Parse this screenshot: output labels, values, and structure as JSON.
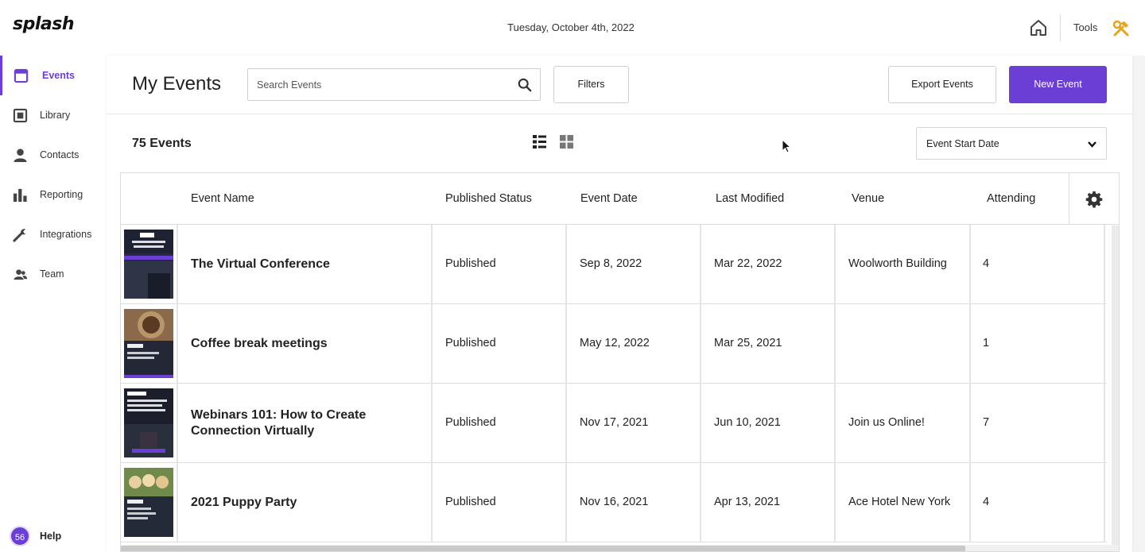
{
  "app": {
    "logo": "splash",
    "date": "Tuesday, October 4th, 2022",
    "tools_label": "Tools"
  },
  "sidebar": {
    "items": [
      {
        "label": "Events",
        "icon": "calendar-icon",
        "active": true
      },
      {
        "label": "Library",
        "icon": "library-icon",
        "active": false
      },
      {
        "label": "Contacts",
        "icon": "person-icon",
        "active": false
      },
      {
        "label": "Reporting",
        "icon": "bar-chart-icon",
        "active": false
      },
      {
        "label": "Integrations",
        "icon": "wrench-icon",
        "active": false
      },
      {
        "label": "Team",
        "icon": "team-icon",
        "active": false
      }
    ],
    "help": {
      "badge": "56",
      "label": "Help"
    }
  },
  "header": {
    "title": "My Events",
    "search_placeholder": "Search Events",
    "filters_label": "Filters",
    "export_label": "Export Events",
    "new_event_label": "New Event"
  },
  "toolbar": {
    "count": "75 Events",
    "sort_value": "Event Start Date"
  },
  "table": {
    "columns": [
      "Event Name",
      "Published Status",
      "Event Date",
      "Last Modified",
      "Venue",
      "Attending"
    ],
    "rows": [
      {
        "name": "The Virtual Conference",
        "status": "Published",
        "event_date": "Sep 8, 2022",
        "modified": "Mar 22, 2022",
        "venue": "Woolworth Building",
        "attending": "4"
      },
      {
        "name": "Coffee break meetings",
        "status": "Published",
        "event_date": "May 12, 2022",
        "modified": "Mar 25, 2021",
        "venue": "",
        "attending": "1"
      },
      {
        "name": "Webinars 101: How to Create Connection Virtually",
        "status": "Published",
        "event_date": "Nov 17, 2021",
        "modified": "Jun 10, 2021",
        "venue": "Join us Online!",
        "attending": "7"
      },
      {
        "name": "2021 Puppy Party",
        "status": "Published",
        "event_date": "Nov 16, 2021",
        "modified": "Apr 13, 2021",
        "venue": "Ace Hotel New York",
        "attending": "4"
      }
    ]
  },
  "colors": {
    "accent": "#6b3fd6",
    "text": "#222222",
    "border": "#dcdcdc"
  }
}
